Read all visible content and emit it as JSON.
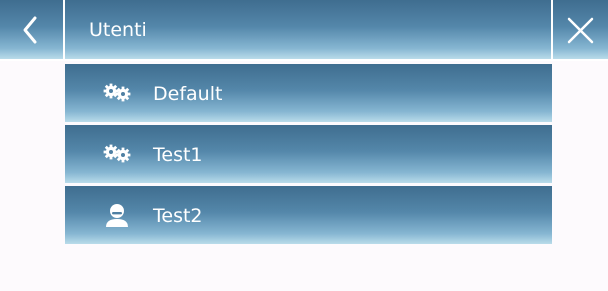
{
  "header": {
    "title": "Utenti",
    "back_icon": "chevron-left-icon",
    "close_icon": "close-icon"
  },
  "users": [
    {
      "label": "Default",
      "icon": "gears-icon"
    },
    {
      "label": "Test1",
      "icon": "gears-icon"
    },
    {
      "label": "Test2",
      "icon": "user-icon"
    }
  ],
  "colors": {
    "bar_dark": "#3f6d8f",
    "bar_light": "#b9dcea",
    "background": "#fdfafd",
    "text": "#ffffff"
  }
}
